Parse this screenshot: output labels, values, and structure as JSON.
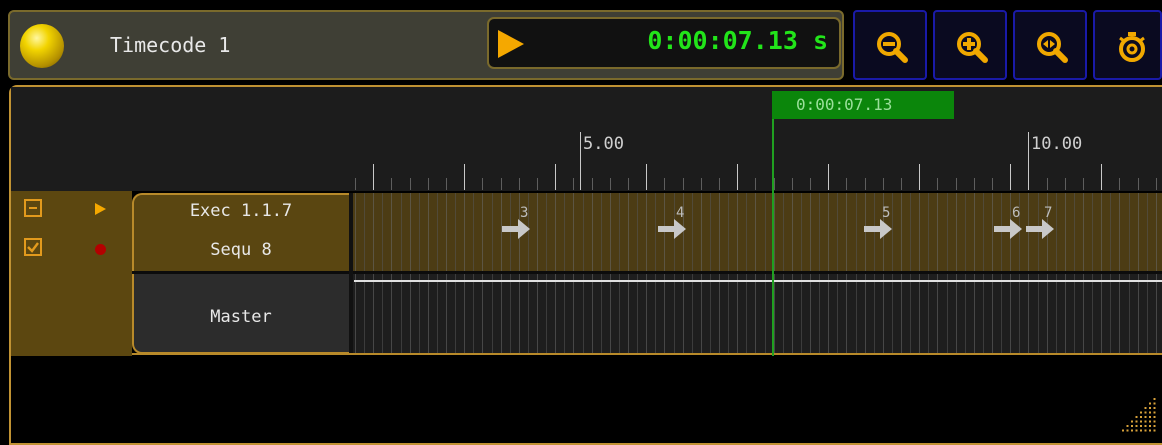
{
  "window": {
    "title": "Timecode 1"
  },
  "playback": {
    "time": "0:00:07.13 s"
  },
  "toolbar": {
    "buttons": [
      {
        "name": "zoom-out",
        "icon": "zoom-out-icon"
      },
      {
        "name": "zoom-in",
        "icon": "zoom-in-icon"
      },
      {
        "name": "zoom-fit",
        "icon": "zoom-fit-icon"
      },
      {
        "name": "timer",
        "icon": "stopwatch-icon"
      }
    ]
  },
  "ruler": {
    "labels": [
      "5.00",
      "10.00"
    ],
    "cursor_label": "0:00:07.13"
  },
  "tracks": [
    {
      "lines": [
        "Exec 1.1.7",
        "Sequ 8"
      ],
      "cues": [
        "3",
        "4",
        "5",
        "6",
        "7"
      ]
    },
    {
      "lines": [
        "Master"
      ]
    }
  ],
  "colors": {
    "accent": "#f5a800",
    "time": "#22e41a",
    "cursor": "#0b860b",
    "track_bg": "#4c3c14",
    "button_border": "#1a1aa8"
  }
}
